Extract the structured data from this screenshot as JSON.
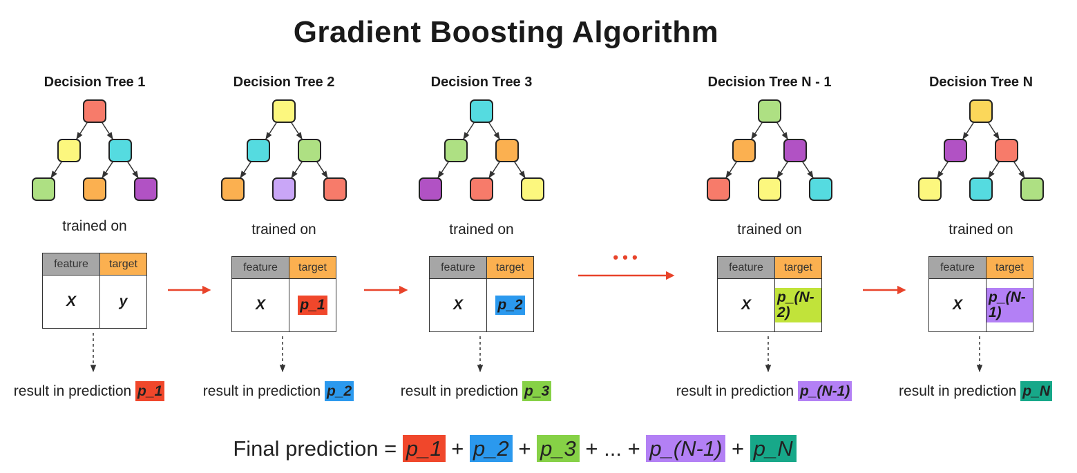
{
  "title": "Gradient Boosting Algorithm",
  "colors": {
    "red": "#f0472b",
    "blue": "#2b99ee",
    "green": "#86d146",
    "purple": "#b380f5",
    "teal": "#17a889",
    "arrow": "#e8432a",
    "header_feature": "#a6a6a6",
    "header_target": "#fbb050"
  },
  "ellipsis": "• • •",
  "stages": [
    {
      "label": "Decision Tree 1",
      "trained_on": "trained on",
      "header_feature": "feature",
      "header_target": "target",
      "x_value": "X",
      "target_value": "y",
      "target_highlight": "",
      "result_text": "result in prediction",
      "prediction": "p_1",
      "prediction_color": "#f0472b",
      "node_colors": [
        "#f77b6a",
        "#fcf77e",
        "#55dbe0",
        "#aee083",
        "#fbb050",
        "#b152c4"
      ]
    },
    {
      "label": "Decision Tree 2",
      "trained_on": "trained on",
      "header_feature": "feature",
      "header_target": "target",
      "x_value": "X",
      "target_value": "p_1",
      "target_highlight": "#f0472b",
      "result_text": "result in prediction",
      "prediction": "p_2",
      "prediction_color": "#2b99ee",
      "node_colors": [
        "#fcf77e",
        "#55dbe0",
        "#aee083",
        "#fbb050",
        "#c9a6f7",
        "#f77b6a"
      ]
    },
    {
      "label": "Decision Tree 3",
      "trained_on": "trained on",
      "header_feature": "feature",
      "header_target": "target",
      "x_value": "X",
      "target_value": "p_2",
      "target_highlight": "#2b99ee",
      "result_text": "result in prediction",
      "prediction": "p_3",
      "prediction_color": "#86d146",
      "node_colors": [
        "#55dbe0",
        "#aee083",
        "#fbb050",
        "#b152c4",
        "#f77b6a",
        "#fcf77e"
      ]
    },
    {
      "label": "Decision Tree N - 1",
      "trained_on": "trained on",
      "header_feature": "feature",
      "header_target": "target",
      "x_value": "X",
      "target_value": "p_(N-2)",
      "target_highlight": "#c1e33a",
      "result_text": "result in prediction",
      "prediction": "p_(N-1)",
      "prediction_color": "#b380f5",
      "node_colors": [
        "#aee083",
        "#fbb050",
        "#b152c4",
        "#f77b6a",
        "#fcf77e",
        "#55dbe0"
      ]
    },
    {
      "label": "Decision Tree N",
      "trained_on": "trained on",
      "header_feature": "feature",
      "header_target": "target",
      "x_value": "X",
      "target_value": "p_(N-1)",
      "target_highlight": "#b380f5",
      "result_text": "result in prediction",
      "prediction": "p_N",
      "prediction_color": "#17a889",
      "node_colors": [
        "#fbd75a",
        "#b152c4",
        "#f77b6a",
        "#fcf77e",
        "#55dbe0",
        "#aee083"
      ]
    }
  ],
  "final": {
    "label": "Final prediction =",
    "terms": [
      {
        "text": "p_1",
        "color": "#f0472b"
      },
      {
        "text": "p_2",
        "color": "#2b99ee"
      },
      {
        "text": "p_3",
        "color": "#86d146"
      },
      {
        "text": "...",
        "color": ""
      },
      {
        "text": "p_(N-1)",
        "color": "#b380f5"
      },
      {
        "text": "p_N",
        "color": "#17a889"
      }
    ],
    "operator": "+"
  }
}
